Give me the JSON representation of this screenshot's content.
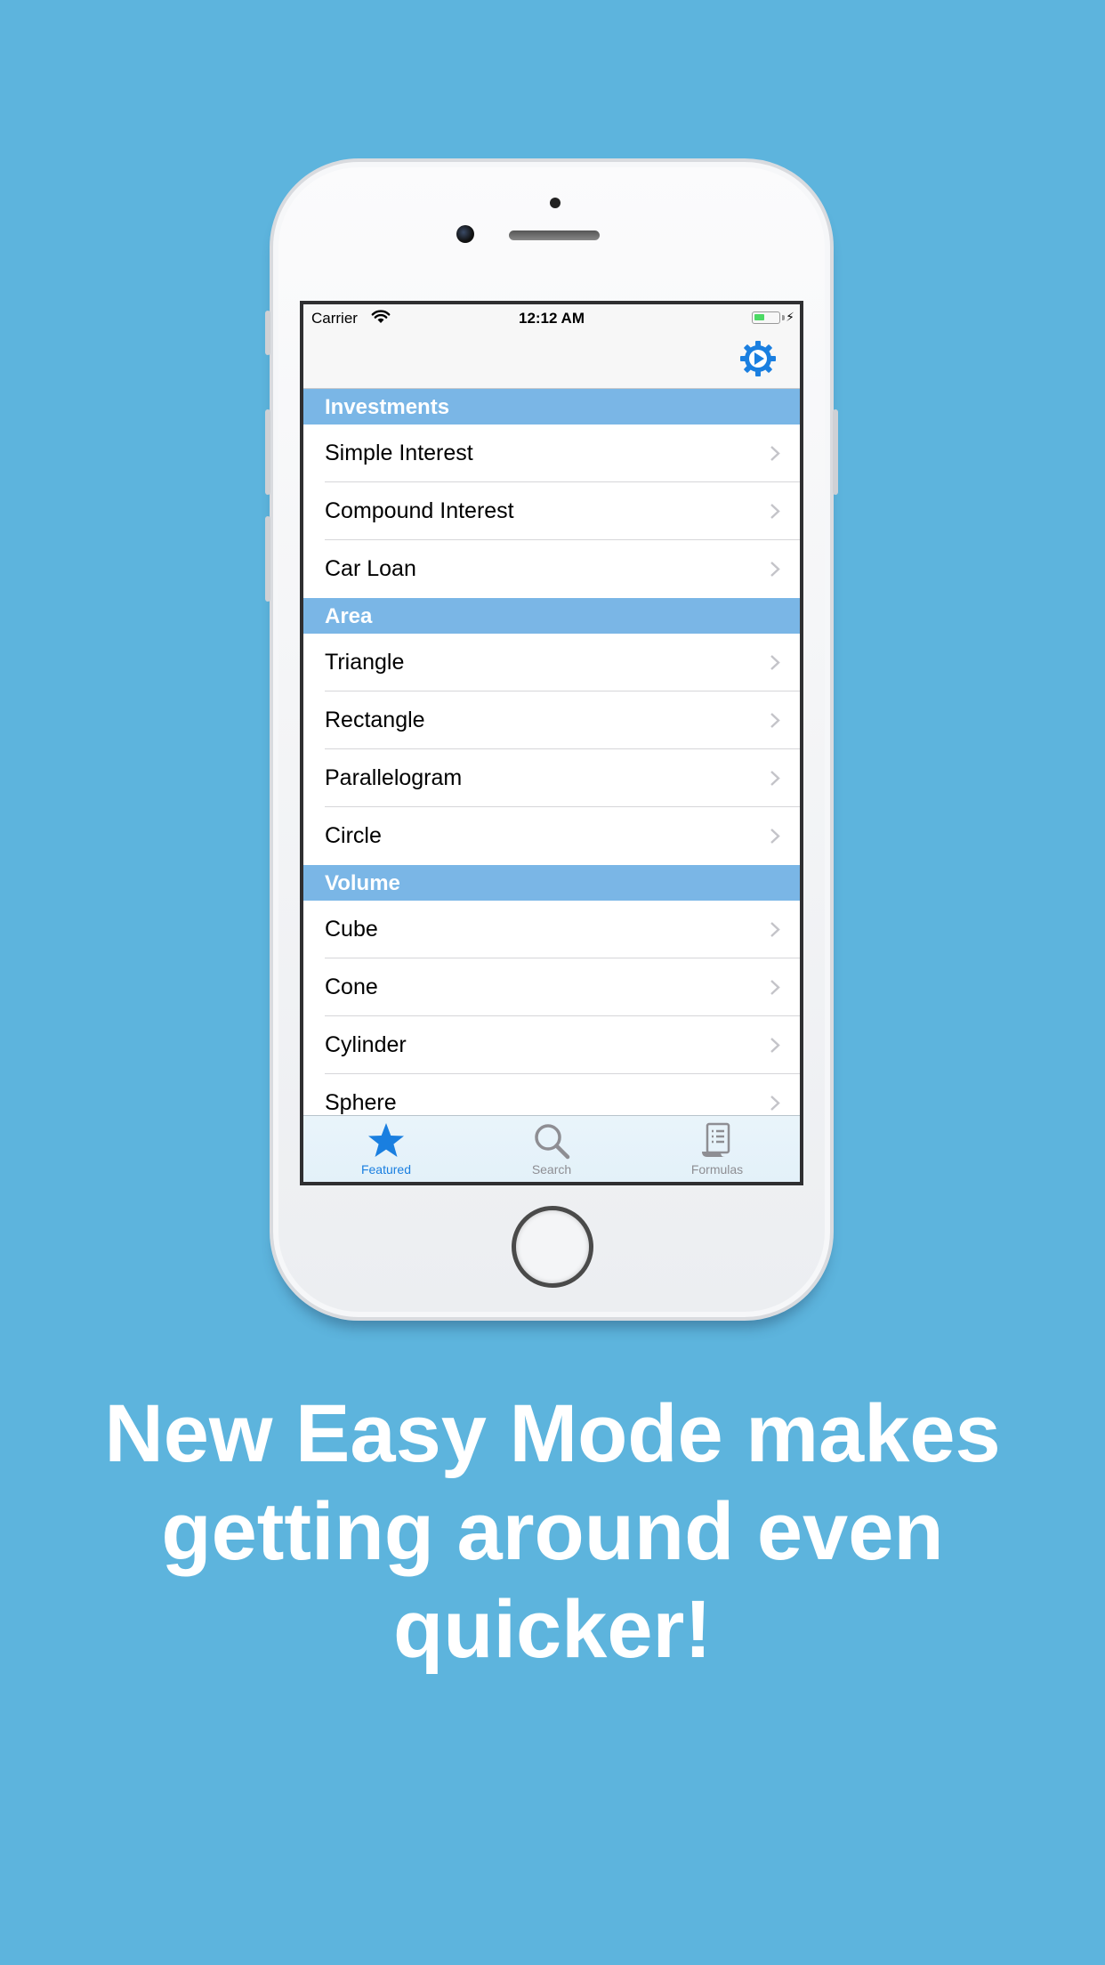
{
  "colors": {
    "background": "#5db4dd",
    "section_header": "#7ab6e6",
    "accent": "#1a7fe0",
    "tab_inactive": "#8e8e93"
  },
  "status_bar": {
    "carrier": "Carrier",
    "time": "12:12 AM",
    "battery_level": 0.45
  },
  "navbar": {
    "settings_icon": "gear-icon"
  },
  "sections": [
    {
      "title": "Investments",
      "rows": [
        "Simple Interest",
        "Compound Interest",
        "Car Loan"
      ]
    },
    {
      "title": "Area",
      "rows": [
        "Triangle",
        "Rectangle",
        "Parallelogram",
        "Circle"
      ]
    },
    {
      "title": "Volume",
      "rows": [
        "Cube",
        "Cone",
        "Cylinder",
        "Sphere"
      ]
    }
  ],
  "tabbar": {
    "tabs": [
      {
        "label": "Featured",
        "icon": "star-icon",
        "selected": true
      },
      {
        "label": "Search",
        "icon": "search-icon",
        "selected": false
      },
      {
        "label": "Formulas",
        "icon": "formulas-icon",
        "selected": false
      }
    ]
  },
  "headline": "New Easy Mode makes getting around even quicker!"
}
